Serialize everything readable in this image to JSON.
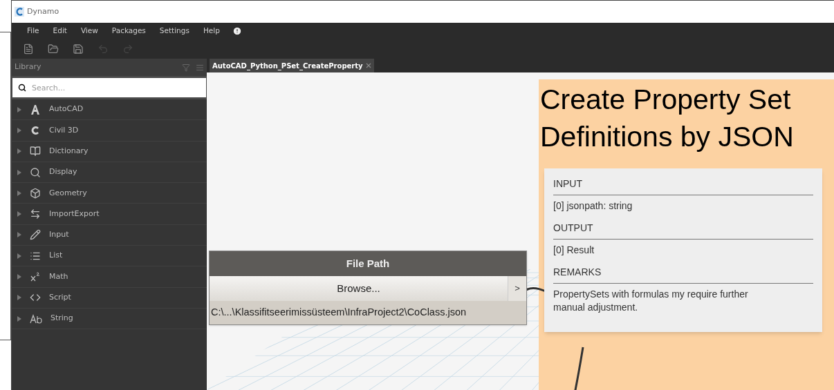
{
  "window": {
    "title": "Dynamo"
  },
  "menu": [
    {
      "label": "File"
    },
    {
      "label": "Edit"
    },
    {
      "label": "View"
    },
    {
      "label": "Packages"
    },
    {
      "label": "Settings"
    },
    {
      "label": "Help"
    }
  ],
  "library": {
    "title": "Library",
    "search": {
      "placeholder": "Search..."
    },
    "items": [
      {
        "label": "AutoCAD",
        "kind": "autocad"
      },
      {
        "label": "Civil 3D",
        "kind": "civil"
      },
      {
        "label": "Dictionary",
        "kind": "book"
      },
      {
        "label": "Display",
        "kind": "search"
      },
      {
        "label": "Geometry",
        "kind": "cube"
      },
      {
        "label": "ImportExport",
        "kind": "arrows"
      },
      {
        "label": "Input",
        "kind": "pencil"
      },
      {
        "label": "List",
        "kind": "list"
      },
      {
        "label": "Math",
        "kind": "math"
      },
      {
        "label": "Script",
        "kind": "code"
      },
      {
        "label": "String",
        "kind": "text"
      }
    ]
  },
  "tabs": [
    {
      "label": "AutoCAD_Python_PSet_CreateProperty",
      "selected": true
    }
  ],
  "canvas": {
    "group": {
      "title": "Create Property Set Definitions by JSON"
    },
    "file_path_node": {
      "title": "File Path",
      "button": "Browse...",
      "port": ">",
      "value": "C:\\...\\Klassifitseerimissüsteem\\InfraProject2\\CoClass.json"
    },
    "info_card": {
      "sections": [
        {
          "heading": "INPUT",
          "text": "[0] jsonpath: string"
        },
        {
          "heading": "OUTPUT",
          "text": "[0] Result"
        },
        {
          "heading": "REMARKS",
          "text": "PropertySets with formulas my require further manual adjustment."
        }
      ]
    }
  }
}
